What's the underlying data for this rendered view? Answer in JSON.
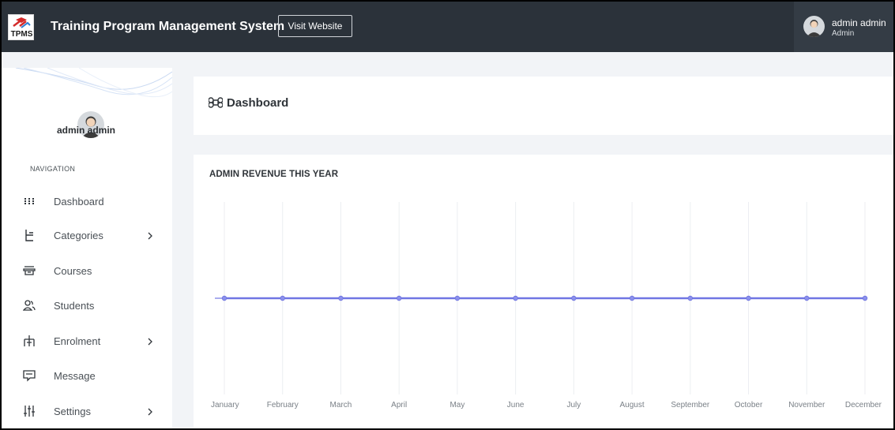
{
  "topbar": {
    "logo_text": "TPMS",
    "app_title": "Training Program Management System",
    "visit_button": "Visit Website",
    "user_name": "admin admin",
    "user_role": "Admin"
  },
  "sidebar": {
    "user_name": "admin admin",
    "nav_heading": "NAVIGATION",
    "items": [
      {
        "label": "Dashboard",
        "icon": "grid-dots-icon",
        "has_submenu": false
      },
      {
        "label": "Categories",
        "icon": "tree-structure-icon",
        "has_submenu": true
      },
      {
        "label": "Courses",
        "icon": "book-stack-icon",
        "has_submenu": false
      },
      {
        "label": "Students",
        "icon": "users-icon",
        "has_submenu": false
      },
      {
        "label": "Enrolment",
        "icon": "hierarchy-icon",
        "has_submenu": true
      },
      {
        "label": "Message",
        "icon": "message-icon",
        "has_submenu": false
      },
      {
        "label": "Settings",
        "icon": "sliders-icon",
        "has_submenu": true
      }
    ]
  },
  "page": {
    "title": "Dashboard"
  },
  "chart_card": {
    "heading": "ADMIN REVENUE THIS YEAR"
  },
  "chart_data": {
    "type": "line",
    "categories": [
      "January",
      "February",
      "March",
      "April",
      "May",
      "June",
      "July",
      "August",
      "September",
      "October",
      "November",
      "December"
    ],
    "values": [
      0,
      0,
      0,
      0,
      0,
      0,
      0,
      0,
      0,
      0,
      0,
      0
    ],
    "line_color": "#7076e3",
    "grid": "vertical"
  },
  "colors": {
    "topbar": "#2b323a",
    "background": "#f2f4f7",
    "accent_line": "#7076e3"
  }
}
